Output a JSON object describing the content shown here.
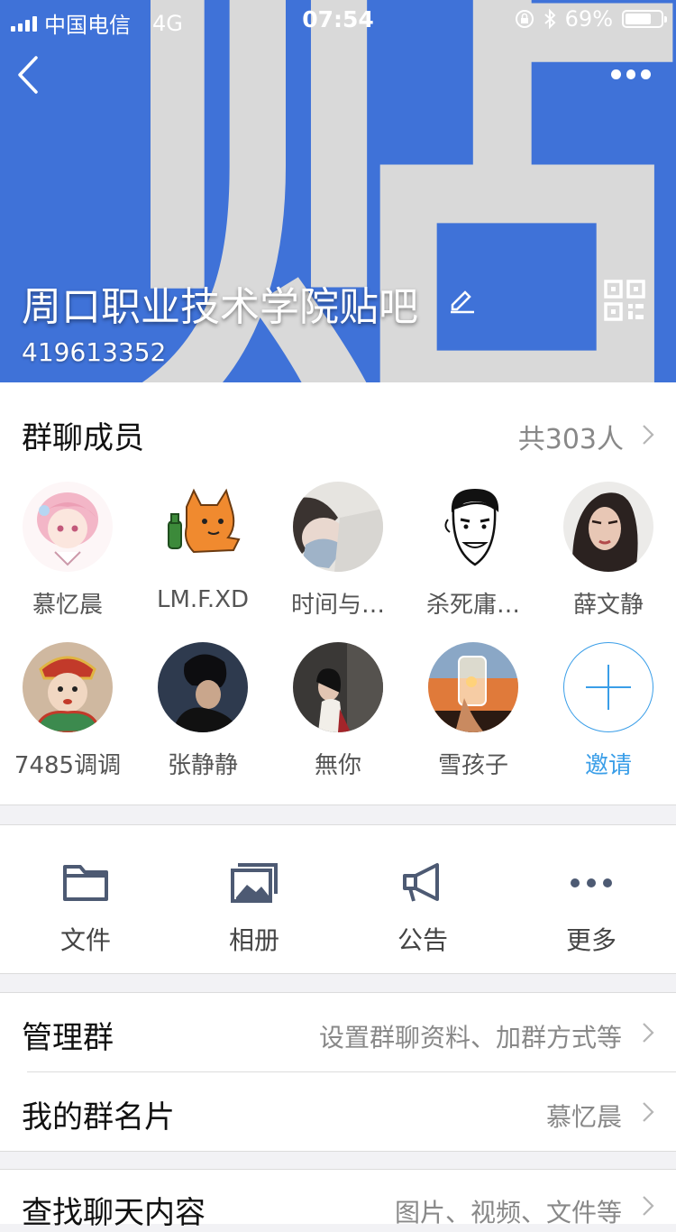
{
  "status_bar": {
    "carrier": "中国电信",
    "network": "4G",
    "time": "07:54",
    "battery": "69%"
  },
  "header": {
    "background_glyph": "贴",
    "group_name": "周口职业技术学院贴吧",
    "group_id": "419613352",
    "accent_color": "#3f72d8"
  },
  "members": {
    "title": "群聊成员",
    "count": "共303人",
    "list": [
      {
        "name": "慕忆晨"
      },
      {
        "name": "LM.F.XD"
      },
      {
        "name": "时间与…"
      },
      {
        "name": "杀死庸…"
      },
      {
        "name": "薛文静"
      },
      {
        "name": "7485调调"
      },
      {
        "name": "张静静"
      },
      {
        "name": "無你"
      },
      {
        "name": "雪孩子"
      }
    ],
    "invite_label": "邀请"
  },
  "tools": [
    {
      "label": "文件",
      "icon": "folder-icon"
    },
    {
      "label": "相册",
      "icon": "album-icon"
    },
    {
      "label": "公告",
      "icon": "announcement-icon"
    },
    {
      "label": "更多",
      "icon": "more-icon"
    }
  ],
  "settings": {
    "manage": {
      "title": "管理群",
      "value": "设置群聊资料、加群方式等"
    },
    "card": {
      "title": "我的群名片",
      "value": "慕忆晨"
    },
    "search": {
      "title": "查找聊天内容",
      "value": "图片、视频、文件等"
    }
  }
}
